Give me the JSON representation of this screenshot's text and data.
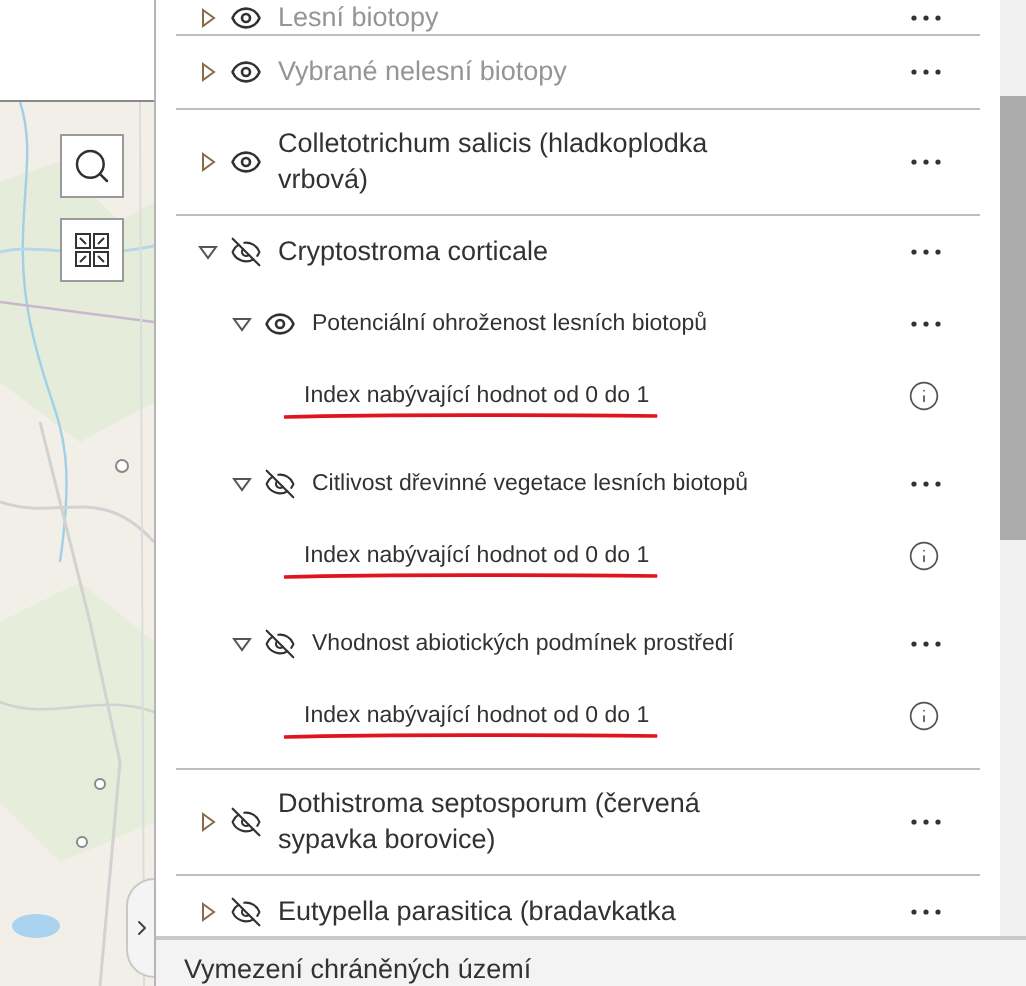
{
  "layers": [
    {
      "name": "Lesní biotopy",
      "visible": true,
      "expanded": false,
      "dimmed": true
    },
    {
      "name": "Vybrané nelesní biotopy",
      "visible": true,
      "expanded": false,
      "dimmed": true
    },
    {
      "name": "Colletotrichum salicis (hladkoplodka vrbová)",
      "visible": true,
      "expanded": false,
      "dimmed": false
    },
    {
      "name": "Cryptostroma corticale",
      "visible": false,
      "expanded": true,
      "dimmed": false,
      "children": [
        {
          "name": "Potenciální ohroženost lesních biotopů",
          "visible": true,
          "expanded": true,
          "legend": {
            "label": "Index nabývající hodnot od 0 do 1",
            "annotated": true
          }
        },
        {
          "name": "Citlivost dřevinné vegetace lesních biotopů",
          "visible": false,
          "expanded": true,
          "legend": {
            "label": "Index nabývající hodnot od 0 do 1",
            "annotated": true
          }
        },
        {
          "name": "Vhodnost abiotických podmínek prostředí",
          "visible": false,
          "expanded": true,
          "legend": {
            "label": "Index nabývající hodnot od 0 do 1",
            "annotated": true
          }
        }
      ]
    },
    {
      "name": "Dothistroma septosporum (červená sypavka borovice)",
      "visible": false,
      "expanded": false,
      "dimmed": false
    },
    {
      "name": "Eutypella parasitica (bradavkatka",
      "visible": false,
      "expanded": false,
      "dimmed": false
    }
  ],
  "footer": {
    "title": "Vymezení chráněných území"
  }
}
